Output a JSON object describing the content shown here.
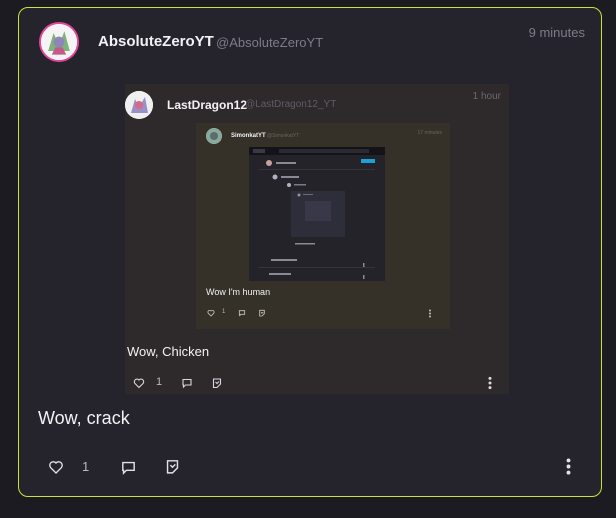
{
  "post": {
    "author_name": "AbsoluteZeroYT",
    "author_handle": "@AbsoluteZeroYT",
    "timestamp": "9 minutes",
    "text": "Wow, crack",
    "like_count": "1",
    "icons": [
      "heart-icon",
      "comment-icon",
      "quote-icon",
      "more-icon"
    ],
    "accent_border": "#c8e23a",
    "avatar_ring": "#e0489a"
  },
  "quoted_post": {
    "author_name": "LastDragon12",
    "author_handle": "@LastDragon12_YT",
    "timestamp": "1 hour",
    "text": "Wow, Chicken",
    "like_count": "1"
  },
  "nested_quoted_post": {
    "author_name": "SimonkatYT",
    "author_handle": "@SimonkatYT",
    "timestamp": "17 minutes",
    "text": "Wow I'm human",
    "like_count": "1"
  }
}
